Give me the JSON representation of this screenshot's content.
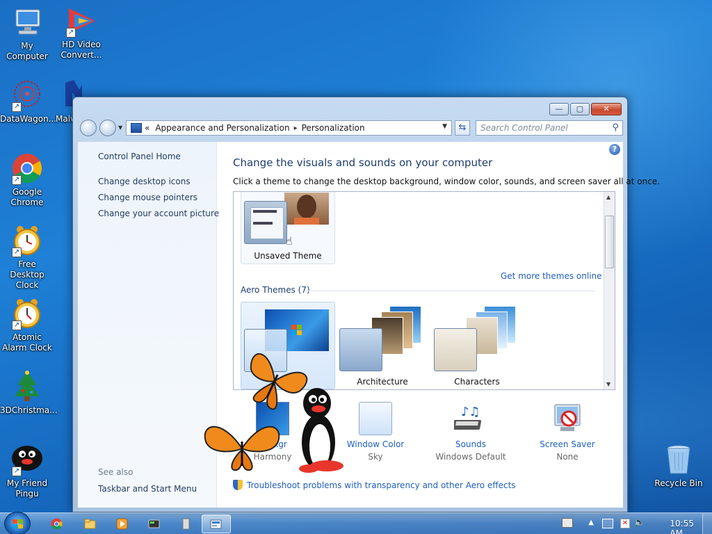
{
  "desktop": {
    "icons": [
      {
        "label": "My Computer"
      },
      {
        "label": "HD Video Convert..."
      },
      {
        "label": "DataWagon..."
      },
      {
        "label": "Malv..."
      },
      {
        "label": "Google Chrome"
      },
      {
        "label": "Free Desktop Clock"
      },
      {
        "label": "Atomic Alarm Clock"
      },
      {
        "label": "3DChristma..."
      },
      {
        "label": "My Friend Pingu"
      },
      {
        "label": "Recycle Bin"
      }
    ]
  },
  "window": {
    "breadcrumb": {
      "prefix": "«",
      "items": [
        "Appearance and Personalization",
        "Personalization"
      ],
      "separator": "▸"
    },
    "search": {
      "placeholder": "Search Control Panel"
    },
    "caption": {
      "minimize": "—",
      "maximize": "▢",
      "close": "✕"
    },
    "sidebar": {
      "links": [
        "Control Panel Home",
        "Change desktop icons",
        "Change mouse pointers",
        "Change your account picture"
      ],
      "see_also": "See also",
      "see_also_links": [
        "Taskbar and Start Menu"
      ]
    },
    "main": {
      "title": "Change the visuals and sounds on your computer",
      "subtitle": "Click a theme to change the desktop background, window color, sounds, and screen saver all at once.",
      "my_themes": [
        {
          "name": "Unsaved Theme"
        }
      ],
      "get_more": "Get more themes online",
      "aero_group": "Aero Themes (7)",
      "aero_themes": [
        {
          "name": "Wi"
        },
        {
          "name": "Architecture"
        },
        {
          "name": "Characters"
        }
      ],
      "bottom": [
        {
          "label": "Backgr",
          "value": "Harmony"
        },
        {
          "label": "Window Color",
          "value": "Sky"
        },
        {
          "label": "Sounds",
          "value": "Windows Default"
        },
        {
          "label": "Screen Saver",
          "value": "None"
        }
      ],
      "troubleshoot": "Troubleshoot problems with transparency and other Aero effects"
    }
  },
  "taskbar": {
    "clock": "10:55 AM"
  }
}
